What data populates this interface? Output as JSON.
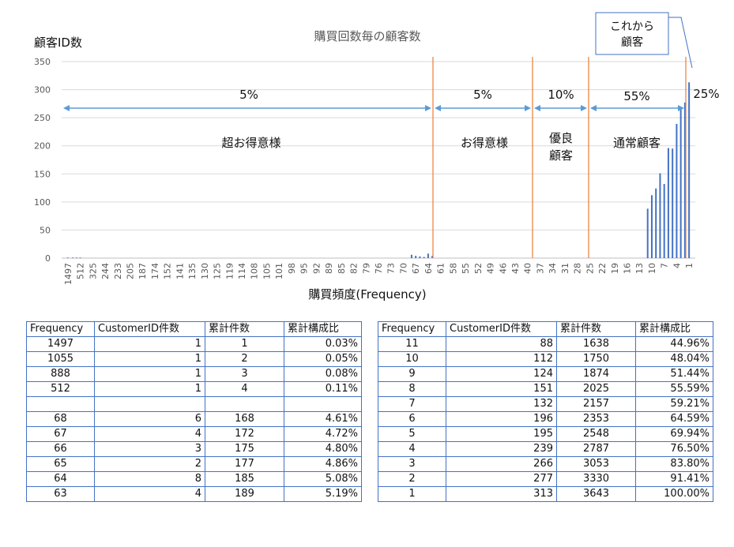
{
  "chart_data": {
    "type": "bar",
    "title": "購買回数毎の顧客数",
    "ylabel": "顧客ID数",
    "xlabel": "購買頻度(Frequency)",
    "ylim": [
      0,
      350
    ],
    "yticks": [
      0,
      50,
      100,
      150,
      200,
      250,
      300,
      350
    ],
    "grid": true,
    "x_tick_labels": [
      "1497",
      "512",
      "325",
      "244",
      "233",
      "205",
      "187",
      "174",
      "152",
      "141",
      "135",
      "130",
      "125",
      "119",
      "114",
      "108",
      "105",
      "101",
      "98",
      "95",
      "92",
      "89",
      "85",
      "82",
      "79",
      "76",
      "73",
      "70",
      "67",
      "64",
      "61",
      "58",
      "55",
      "52",
      "49",
      "46",
      "43",
      "40",
      "37",
      "34",
      "31",
      "28",
      "25",
      "22",
      "19",
      "16",
      "13",
      "10",
      "7",
      "4",
      "1"
    ],
    "categories": [
      "1497",
      "1055",
      "888",
      "512",
      "…",
      "68",
      "67",
      "66",
      "65",
      "64",
      "63",
      "11",
      "10",
      "9",
      "8",
      "7",
      "6",
      "5",
      "4",
      "3",
      "2",
      "1"
    ],
    "values": [
      1,
      1,
      1,
      1,
      null,
      6,
      4,
      3,
      2,
      8,
      4,
      88,
      112,
      124,
      151,
      132,
      196,
      195,
      239,
      266,
      277,
      313
    ],
    "segments": [
      {
        "label": "超お得意様",
        "share": "5%"
      },
      {
        "label": "お得意様",
        "share": "5%"
      },
      {
        "label": "優良\n顧客",
        "share": "10%"
      },
      {
        "label": "通常顧客",
        "share": "55%"
      },
      {
        "label": "",
        "share": "25%"
      }
    ],
    "callout": "これから\n顧客"
  },
  "tables": {
    "headers": [
      "Frequency",
      "CustomerID件数",
      "累計件数",
      "累計構成比"
    ],
    "left_rows": [
      [
        "1497",
        "1",
        "1",
        "0.03%"
      ],
      [
        "1055",
        "1",
        "2",
        "0.05%"
      ],
      [
        "888",
        "1",
        "3",
        "0.08%"
      ],
      [
        "512",
        "1",
        "4",
        "0.11%"
      ],
      [
        "",
        "",
        "",
        ""
      ],
      [
        "68",
        "6",
        "168",
        "4.61%"
      ],
      [
        "67",
        "4",
        "172",
        "4.72%"
      ],
      [
        "66",
        "3",
        "175",
        "4.80%"
      ],
      [
        "65",
        "2",
        "177",
        "4.86%"
      ],
      [
        "64",
        "8",
        "185",
        "5.08%"
      ],
      [
        "63",
        "4",
        "189",
        "5.19%"
      ]
    ],
    "right_rows": [
      [
        "11",
        "88",
        "1638",
        "44.96%"
      ],
      [
        "10",
        "112",
        "1750",
        "48.04%"
      ],
      [
        "9",
        "124",
        "1874",
        "51.44%"
      ],
      [
        "8",
        "151",
        "2025",
        "55.59%"
      ],
      [
        "7",
        "132",
        "2157",
        "59.21%"
      ],
      [
        "6",
        "196",
        "2353",
        "64.59%"
      ],
      [
        "5",
        "195",
        "2548",
        "69.94%"
      ],
      [
        "4",
        "239",
        "2787",
        "76.50%"
      ],
      [
        "3",
        "266",
        "3053",
        "83.80%"
      ],
      [
        "2",
        "277",
        "3330",
        "91.41%"
      ],
      [
        "1",
        "313",
        "3643",
        "100.00%"
      ]
    ]
  },
  "colors": {
    "bar": "#4472c4",
    "divider": "#ed7d31",
    "arrow": "#5b9bd5",
    "grid": "#d9d9d9",
    "table_border": "#4472c4",
    "callout_border": "#4472c4"
  }
}
